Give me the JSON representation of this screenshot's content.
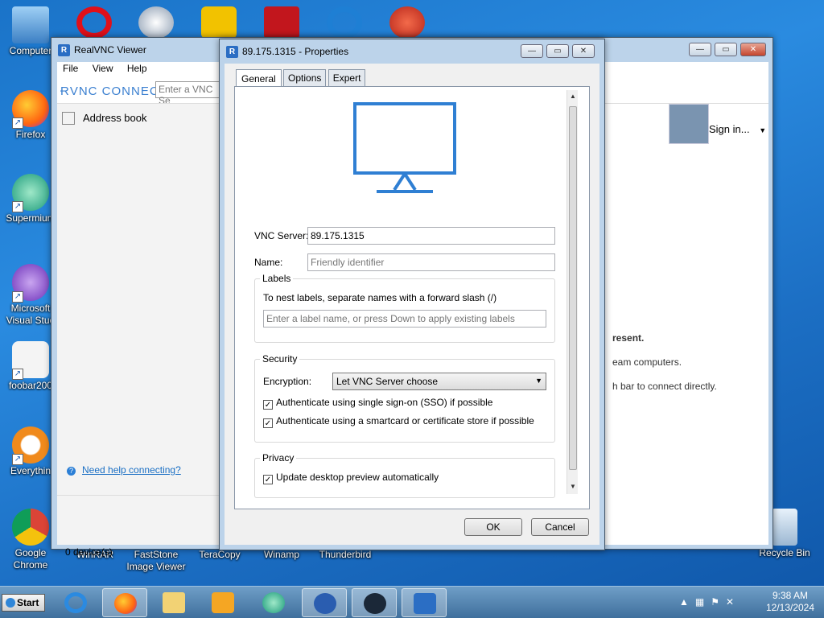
{
  "desktop": {
    "icons": [
      {
        "label": "Computer"
      },
      {
        "label": "Firefox"
      },
      {
        "label": "Supermium"
      },
      {
        "label": "Microsoft Visual Stud"
      },
      {
        "label": "foobar200"
      },
      {
        "label": "Everythin"
      },
      {
        "label": "Google Chrome"
      },
      {
        "label": "WinRAR"
      },
      {
        "label": "FastStone Image Viewer"
      },
      {
        "label": "TeraCopy"
      },
      {
        "label": "Winamp"
      },
      {
        "label": "Thunderbird"
      },
      {
        "label": "Recycle Bin"
      }
    ]
  },
  "main_window": {
    "title": "RealVNC Viewer",
    "menu": [
      "File",
      "View",
      "Help"
    ],
    "logo": "ɌVNC CONNECT",
    "search_placeholder": "Enter a VNC Se",
    "address_book": "Address book",
    "sign_in": "Sign in...",
    "help_link": "Need help connecting?",
    "device_count": "0 device(s)",
    "empty_lines": [
      "resent.",
      "eam computers.",
      "h bar to connect directly."
    ]
  },
  "dialog": {
    "title": "89.175.1315 - Properties",
    "tabs": [
      "General",
      "Options",
      "Expert"
    ],
    "vnc_server_label": "VNC Server:",
    "vnc_server_value": "89.175.1315",
    "name_label": "Name:",
    "name_placeholder": "Friendly identifier",
    "labels_group": "Labels",
    "labels_hint": "To nest labels, separate names with a forward slash (/)",
    "labels_placeholder": "Enter a label name, or press Down to apply existing labels",
    "security_group": "Security",
    "encryption_label": "Encryption:",
    "encryption_value": "Let VNC Server choose",
    "sso_check": "Authenticate using single sign-on (SSO) if possible",
    "smartcard_check": "Authenticate using a smartcard or certificate store if possible",
    "privacy_group": "Privacy",
    "preview_check": "Update desktop preview automatically",
    "ok": "OK",
    "cancel": "Cancel"
  },
  "taskbar": {
    "start": "Start",
    "time": "9:38 AM",
    "date": "12/13/2024"
  }
}
